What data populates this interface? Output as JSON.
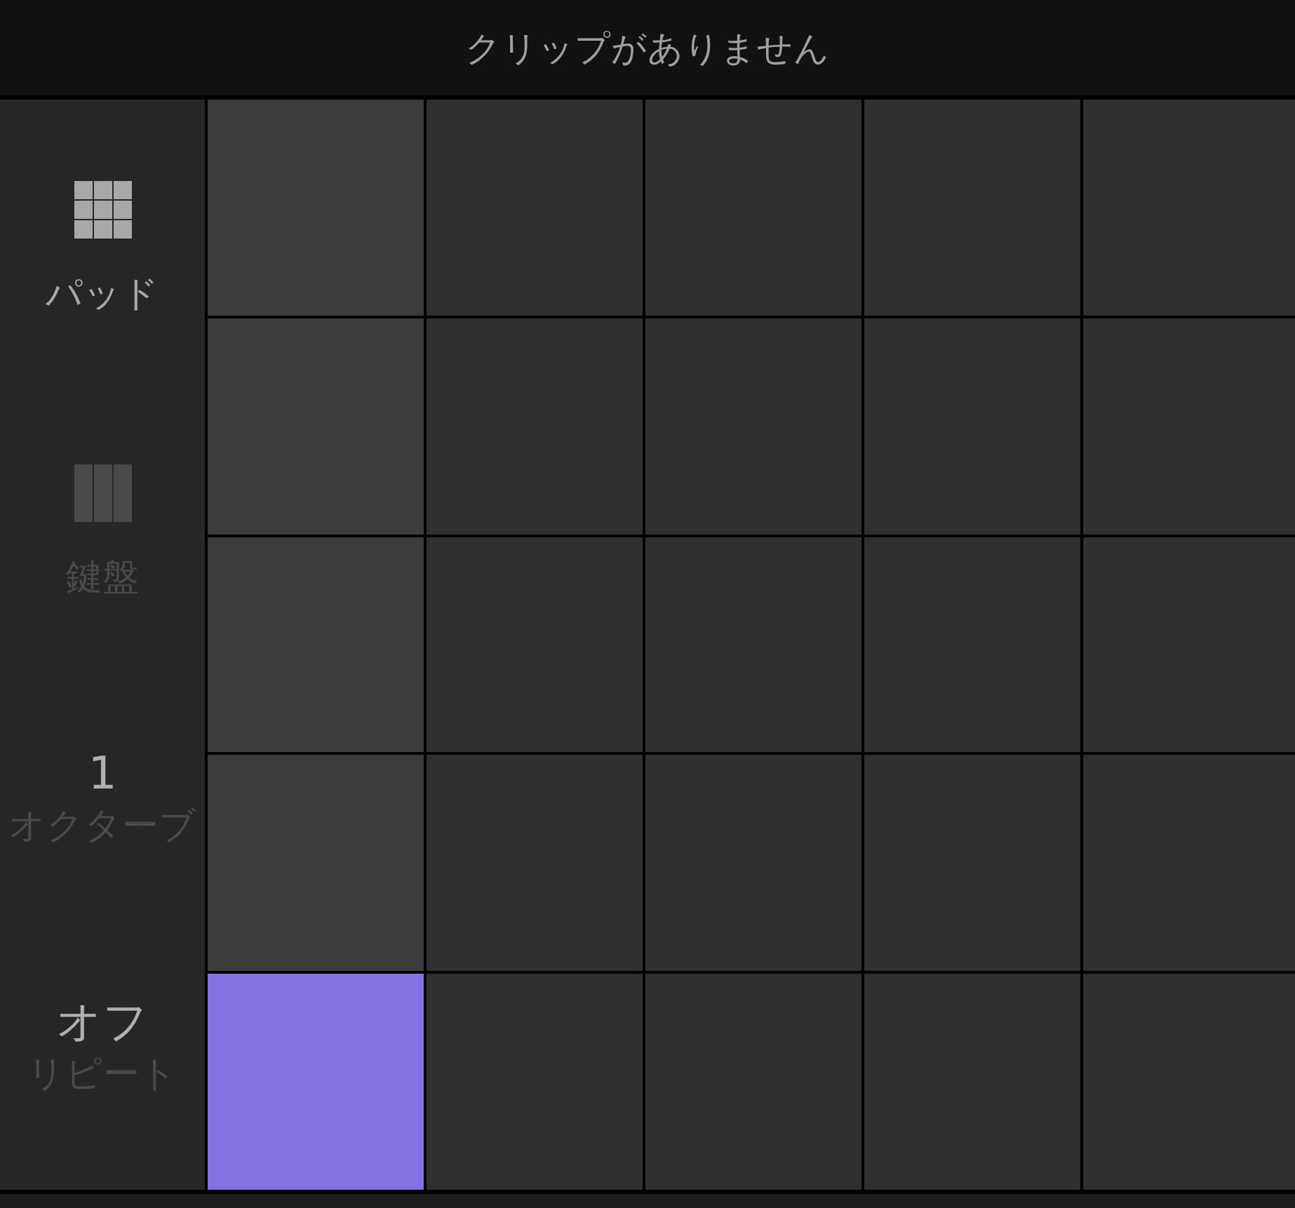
{
  "title_bar": {
    "title": "クリップがありません"
  },
  "sidebar": {
    "items": [
      {
        "kind": "pads",
        "label": "パッド",
        "selected": true
      },
      {
        "kind": "keys",
        "label": "鍵盤",
        "selected": false
      },
      {
        "kind": "setting",
        "value": "1",
        "label": "オクターブ"
      },
      {
        "kind": "setting",
        "value": "オフ",
        "label": "リピート"
      }
    ]
  },
  "pad_rows": [
    {
      "pads": [
        {
          "color": "#3c3c3c"
        },
        {
          "color": "#303030"
        },
        {
          "color": "#303030"
        },
        {
          "color": "#303030"
        },
        {
          "color": "#303030"
        }
      ]
    },
    {
      "pads": [
        {
          "color": "#3c3c3c"
        },
        {
          "color": "#303030"
        },
        {
          "color": "#303030"
        },
        {
          "color": "#303030"
        },
        {
          "color": "#303030"
        }
      ]
    },
    {
      "pads": [
        {
          "color": "#3c3c3c"
        },
        {
          "color": "#303030"
        },
        {
          "color": "#303030"
        },
        {
          "color": "#303030"
        },
        {
          "color": "#303030"
        }
      ]
    },
    {
      "pads": [
        {
          "color": "#3c3c3c"
        },
        {
          "color": "#303030"
        },
        {
          "color": "#303030"
        },
        {
          "color": "#303030"
        },
        {
          "color": "#303030"
        }
      ]
    },
    {
      "pads": [
        {
          "color": "#8470e0"
        },
        {
          "color": "#303030"
        },
        {
          "color": "#303030"
        },
        {
          "color": "#303030"
        },
        {
          "color": "#303030"
        }
      ]
    }
  ]
}
